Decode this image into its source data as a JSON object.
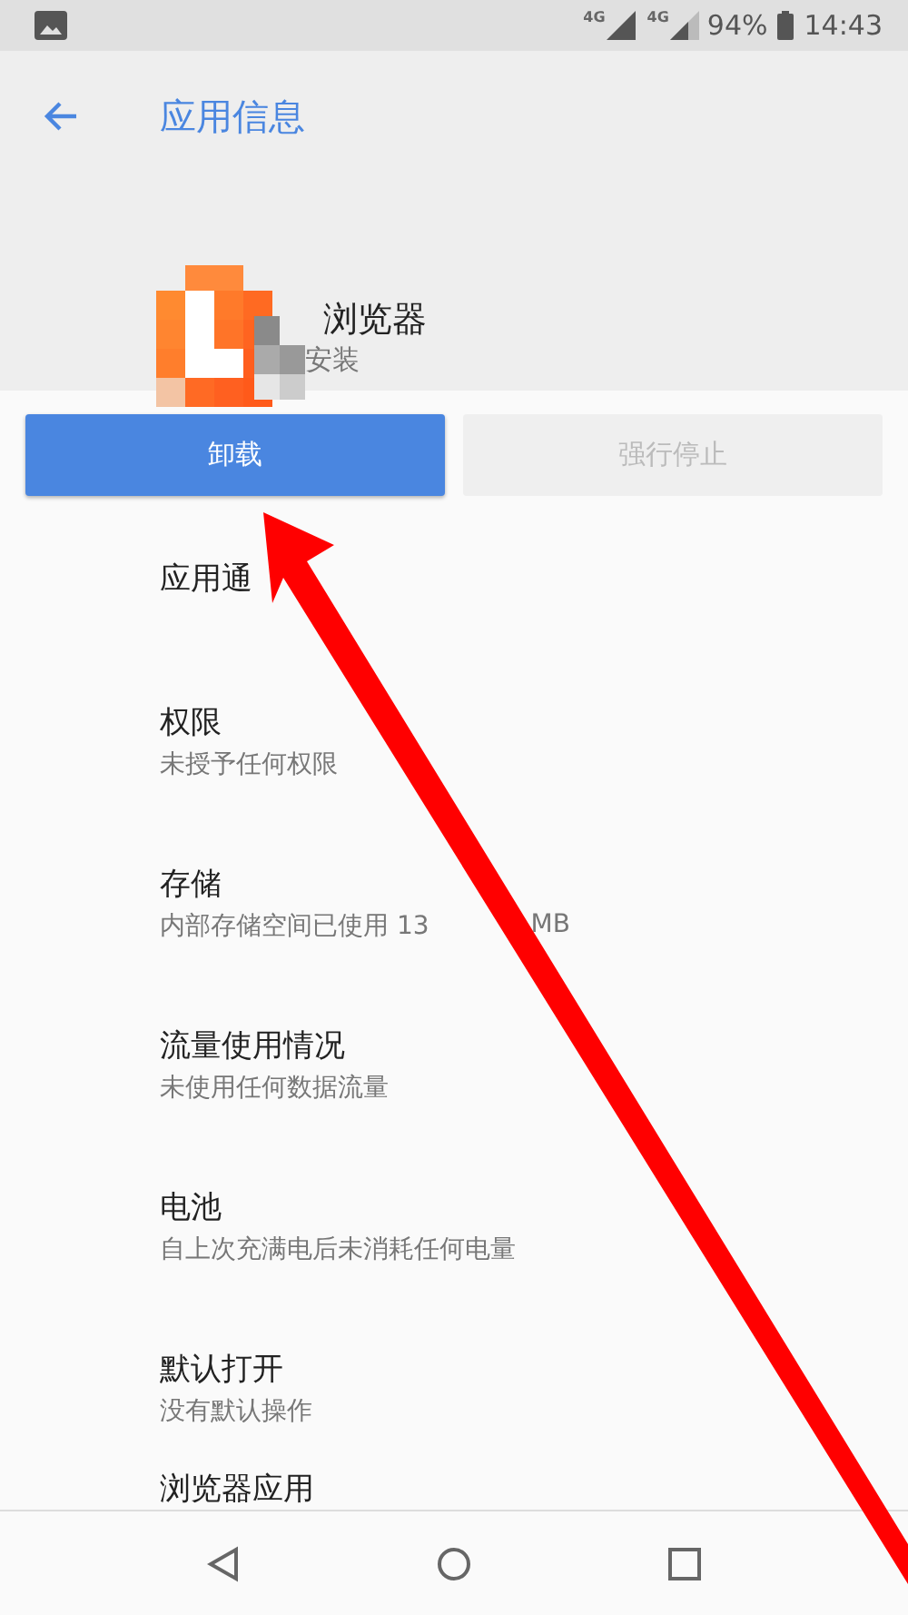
{
  "status_bar": {
    "sim_labels": [
      "4G",
      "4G"
    ],
    "battery": "94%",
    "time": "14:43"
  },
  "toolbar": {
    "title": "应用信息"
  },
  "app": {
    "name": "浏览器",
    "status": "安装"
  },
  "buttons": [
    {
      "label": "卸载",
      "disabled": false
    },
    {
      "label": "强行停止",
      "disabled": true
    }
  ],
  "settings": [
    {
      "title": "应用通"
    },
    {
      "title": "权限",
      "summary": "未授予任何权限"
    },
    {
      "title": "存储",
      "summary": "内部存储空间已使用 13",
      "summary_tail": "MB"
    },
    {
      "title": "流量使用情况",
      "summary": "未使用任何数据流量"
    },
    {
      "title": "电池",
      "summary": "自上次充满电后未消耗任何电量"
    },
    {
      "title": "默认打开",
      "summary": "没有默认操作"
    },
    {
      "title": "浏览器应用"
    }
  ]
}
